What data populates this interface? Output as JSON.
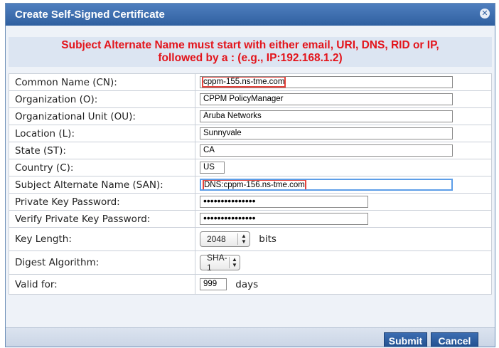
{
  "dialog": {
    "title": "Create Self-Signed Certificate",
    "close_icon": "close-icon",
    "alert_line1": "Subject Alternate Name must start with either email, URI, DNS, RID or IP,",
    "alert_line2": "followed by a : (e.g., IP:192.168.1.2)"
  },
  "fields": {
    "cn": {
      "label": "Common Name (CN):",
      "value": "cppm-155.ns-tme.com"
    },
    "o": {
      "label": "Organization (O):",
      "value": "CPPM PolicyManager"
    },
    "ou": {
      "label": "Organizational Unit (OU):",
      "value": "Aruba Networks"
    },
    "l": {
      "label": "Location (L):",
      "value": "Sunnyvale"
    },
    "st": {
      "label": "State (ST):",
      "value": "CA"
    },
    "c": {
      "label": "Country (C):",
      "value": "US"
    },
    "san": {
      "label": "Subject Alternate Name (SAN):",
      "value": "DNS:cppm-156.ns-tme.com"
    },
    "pkp": {
      "label": "Private Key Password:",
      "value": "•••••••••••••••"
    },
    "vpkp": {
      "label": "Verify Private Key Password:",
      "value": "•••••••••••••••"
    },
    "keylen": {
      "label": "Key Length:",
      "value": "2048",
      "unit": "bits"
    },
    "digest": {
      "label": "Digest Algorithm:",
      "value": "SHA-1"
    },
    "valid": {
      "label": "Valid for:",
      "value": "999",
      "unit": "days"
    }
  },
  "buttons": {
    "submit": "Submit",
    "cancel": "Cancel"
  },
  "colors": {
    "title_bar": "#2f5f9f",
    "alert_text": "#e3141b",
    "highlight_box": "#e5433c",
    "button": "#22508f"
  }
}
